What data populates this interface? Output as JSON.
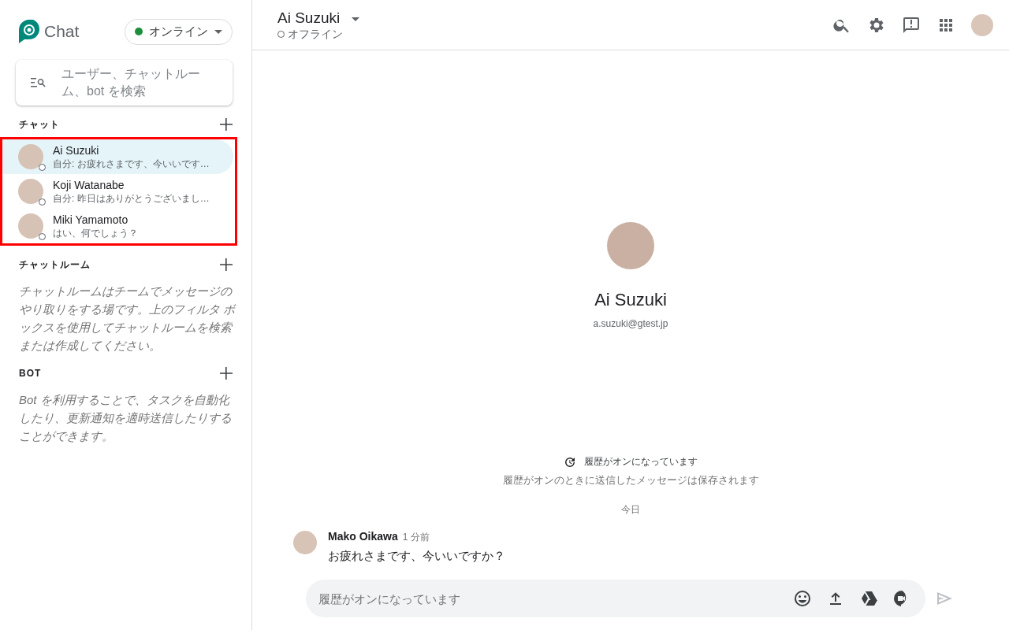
{
  "app": {
    "name": "Chat"
  },
  "status_button": {
    "label": "オンライン",
    "online": true
  },
  "search": {
    "placeholder": "ユーザー、チャットルーム、bot を検索"
  },
  "sections": [
    {
      "title": "チャット",
      "kind": "list",
      "items": [
        {
          "name": "Ai Suzuki",
          "preview": "自分: お疲れさまです、今いいです…",
          "selected": true,
          "online": false
        },
        {
          "name": "Koji Watanabe",
          "preview": "自分: 昨日はありがとうございまし…",
          "selected": false,
          "online": false
        },
        {
          "name": "Miki Yamamoto",
          "preview": "はい、何でしょう？",
          "selected": false,
          "online": false
        }
      ]
    },
    {
      "title": "チャットルーム",
      "kind": "hint",
      "text": "チャットルームはチームでメッセージのやり取りをする場です。上のフィルタ ボックスを使用してチャットルームを検索または作成してください。"
    },
    {
      "title": "BOT",
      "kind": "hint",
      "text": "Bot を利用することで、タスクを自動化したり、更新通知を適時送信したりすることができます。"
    }
  ],
  "header": {
    "title": "Ai Suzuki",
    "status": "オフライン",
    "online": false
  },
  "profile": {
    "name": "Ai Suzuki",
    "email": "a.suzuki@gtest.jp"
  },
  "history": {
    "title": "履歴がオンになっています",
    "note": "履歴がオンのときに送信したメッセージは保存されます"
  },
  "date_divider": "今日",
  "messages": [
    {
      "sender": "Mako Oikawa",
      "time": "1 分前",
      "text": "お疲れさまです、今いいですか？"
    }
  ],
  "composer": {
    "placeholder": "履歴がオンになっています"
  }
}
